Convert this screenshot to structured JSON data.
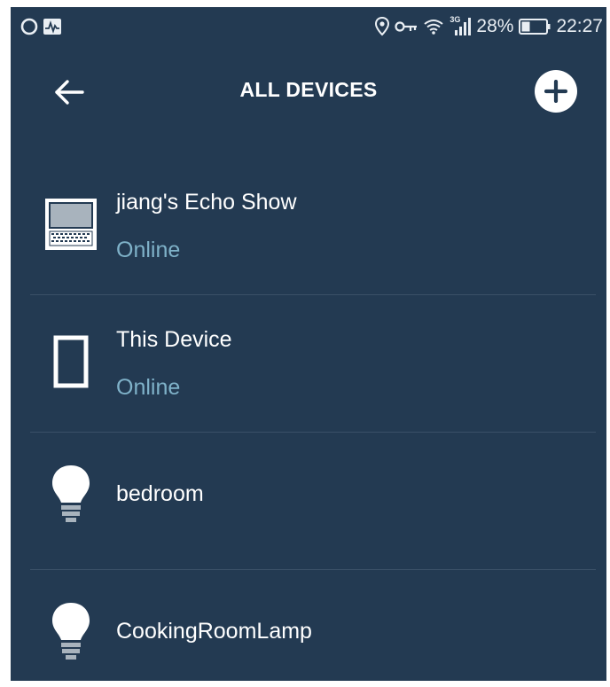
{
  "status_bar": {
    "battery_percent": "28%",
    "time": "22:27",
    "network_type": "3G",
    "icons": [
      "circle-icon",
      "activity-icon",
      "location-icon",
      "key-icon",
      "wifi-icon",
      "signal-icon",
      "battery-icon"
    ]
  },
  "header": {
    "title": "ALL DEVICES",
    "back_icon": "arrow-left-icon",
    "add_icon": "plus-icon"
  },
  "devices": [
    {
      "name": "jiang's Echo Show",
      "status": "Online",
      "icon": "echo-show-icon"
    },
    {
      "name": "This Device",
      "status": "Online",
      "icon": "tablet-icon"
    },
    {
      "name": "bedroom",
      "icon": "light-bulb-icon"
    },
    {
      "name": "CookingRoomLamp",
      "icon": "light-bulb-icon"
    }
  ],
  "colors": {
    "background": "#233a52",
    "status_online": "#7fb2c9",
    "text": "#ffffff",
    "divider": "#3a5067"
  }
}
